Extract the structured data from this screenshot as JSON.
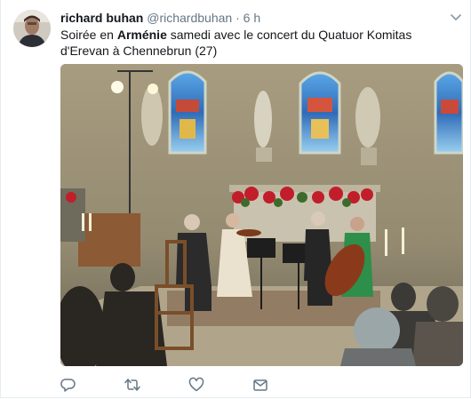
{
  "tweet": {
    "author_name": "richard buhan",
    "author_handle": "@richardbuhan",
    "separator": "·",
    "time": "6 h",
    "text_before": "Soirée en ",
    "text_bold": "Arménie",
    "text_after": " samedi avec le concert du Quatuor Komitas d'Erevan à Chennebrun (27)"
  },
  "actions": {
    "reply_icon": "reply-icon",
    "retweet_icon": "retweet-icon",
    "like_icon": "heart-icon",
    "message_icon": "envelope-icon"
  },
  "colors": {
    "name": "#14171a",
    "secondary": "#657786",
    "border": "#e6ecf0"
  }
}
